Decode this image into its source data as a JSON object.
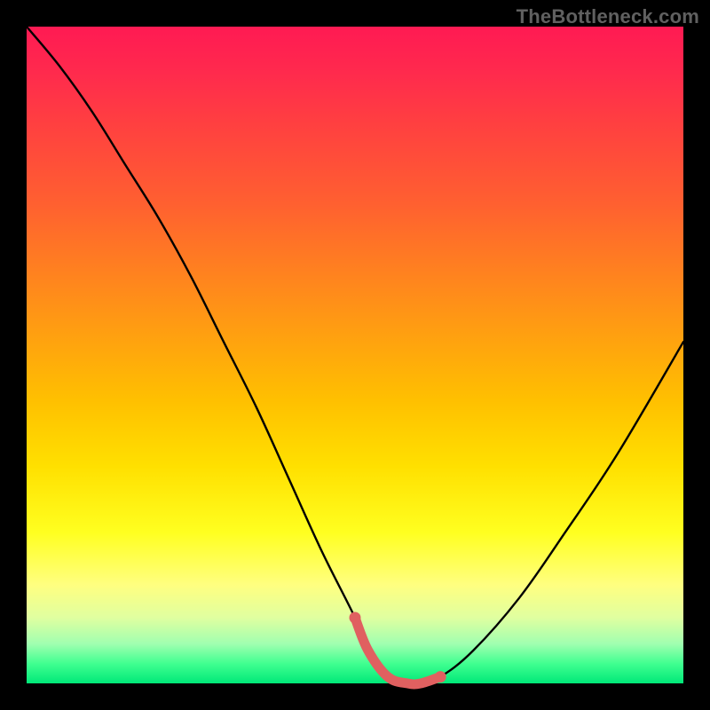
{
  "watermark": "TheBottleneck.com",
  "chart_data": {
    "type": "line",
    "title": "",
    "xlabel": "",
    "ylabel": "",
    "xlim": [
      0,
      100
    ],
    "ylim": [
      0,
      100
    ],
    "grid": false,
    "series": [
      {
        "name": "bottleneck-curve",
        "x": [
          0,
          5,
          10,
          15,
          20,
          25,
          30,
          35,
          40,
          45,
          50,
          52,
          55,
          58,
          60,
          63,
          68,
          75,
          82,
          90,
          100
        ],
        "values": [
          100,
          94,
          87,
          79,
          71,
          62,
          52,
          42,
          31,
          20,
          10,
          5,
          1,
          0,
          0,
          1,
          5,
          13,
          23,
          35,
          52
        ]
      }
    ],
    "highlight": {
      "name": "optimal-region",
      "color": "#e06060",
      "x": [
        50,
        52,
        55,
        58,
        60,
        63
      ],
      "values": [
        10,
        5,
        1,
        0,
        0,
        1
      ]
    },
    "gradient_bands": [
      {
        "position": 0,
        "color": "#ff1a53"
      },
      {
        "position": 50,
        "color": "#ffbf00"
      },
      {
        "position": 85,
        "color": "#ffff60"
      },
      {
        "position": 100,
        "color": "#00e878"
      }
    ]
  }
}
